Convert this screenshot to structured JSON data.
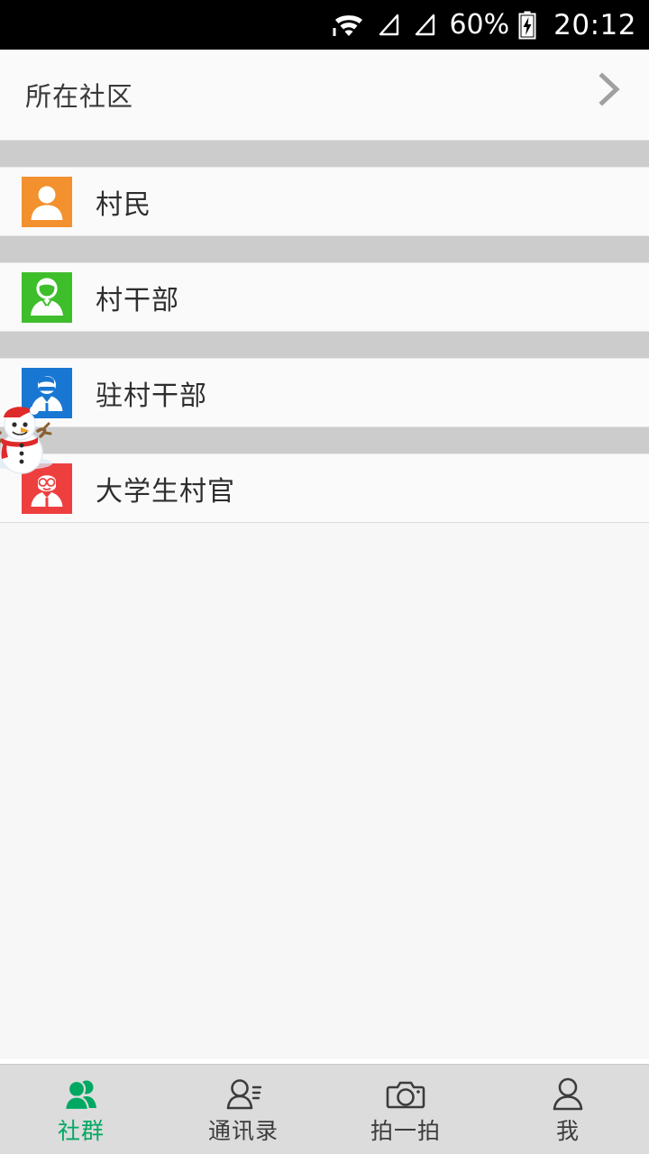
{
  "status_bar": {
    "wifi_icon": "wifi-icon",
    "signal1_icon": "signal-triangle-icon",
    "signal2_icon": "signal-triangle-icon",
    "battery_percent": "60%",
    "battery_icon": "battery-charging-icon",
    "time": "20:12"
  },
  "header": {
    "title": "所在社区",
    "chevron": "›",
    "chevron_icon": "chevron-right-icon"
  },
  "list": {
    "items": [
      {
        "label": "村民",
        "icon": "villager-avatar-icon",
        "color": "#F2912E"
      },
      {
        "label": "村干部",
        "icon": "village-cadre-avatar-icon",
        "color": "#3FBE2C"
      },
      {
        "label": "驻村干部",
        "icon": "resident-cadre-avatar-icon",
        "color": "#1877D2"
      },
      {
        "label": "大学生村官",
        "icon": "student-official-avatar-icon",
        "color": "#EE3F3F"
      }
    ]
  },
  "floating_widget": {
    "name": "snowman-widget",
    "hat_color": "#E02A2A",
    "scarf_color": "#E02A2A",
    "body_color": "#FFFFFF",
    "arm_color": "#8A6033"
  },
  "tabbar": {
    "active_color": "#00A862",
    "inactive_color": "#3C3C3C",
    "tabs": [
      {
        "label": "社群",
        "icon": "group-people-icon",
        "active": true
      },
      {
        "label": "通讯录",
        "icon": "contacts-icon",
        "active": false
      },
      {
        "label": "拍一拍",
        "icon": "camera-icon",
        "active": false
      },
      {
        "label": "我",
        "icon": "profile-person-icon",
        "active": false
      }
    ]
  }
}
